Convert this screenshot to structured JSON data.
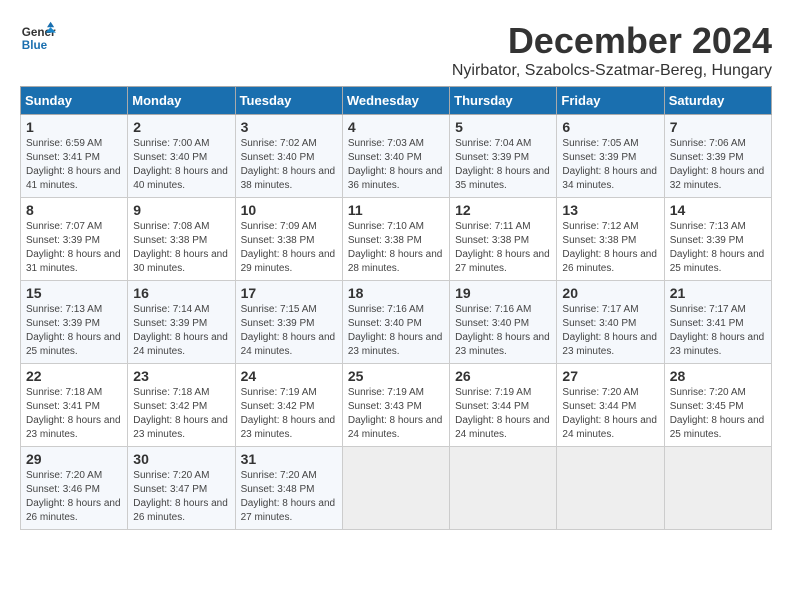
{
  "logo": {
    "line1": "General",
    "line2": "Blue"
  },
  "title": "December 2024",
  "subtitle": "Nyirbator, Szabolcs-Szatmar-Bereg, Hungary",
  "weekdays": [
    "Sunday",
    "Monday",
    "Tuesday",
    "Wednesday",
    "Thursday",
    "Friday",
    "Saturday"
  ],
  "weeks": [
    [
      {
        "day": "1",
        "sunrise": "Sunrise: 6:59 AM",
        "sunset": "Sunset: 3:41 PM",
        "daylight": "Daylight: 8 hours and 41 minutes."
      },
      {
        "day": "2",
        "sunrise": "Sunrise: 7:00 AM",
        "sunset": "Sunset: 3:40 PM",
        "daylight": "Daylight: 8 hours and 40 minutes."
      },
      {
        "day": "3",
        "sunrise": "Sunrise: 7:02 AM",
        "sunset": "Sunset: 3:40 PM",
        "daylight": "Daylight: 8 hours and 38 minutes."
      },
      {
        "day": "4",
        "sunrise": "Sunrise: 7:03 AM",
        "sunset": "Sunset: 3:40 PM",
        "daylight": "Daylight: 8 hours and 36 minutes."
      },
      {
        "day": "5",
        "sunrise": "Sunrise: 7:04 AM",
        "sunset": "Sunset: 3:39 PM",
        "daylight": "Daylight: 8 hours and 35 minutes."
      },
      {
        "day": "6",
        "sunrise": "Sunrise: 7:05 AM",
        "sunset": "Sunset: 3:39 PM",
        "daylight": "Daylight: 8 hours and 34 minutes."
      },
      {
        "day": "7",
        "sunrise": "Sunrise: 7:06 AM",
        "sunset": "Sunset: 3:39 PM",
        "daylight": "Daylight: 8 hours and 32 minutes."
      }
    ],
    [
      {
        "day": "8",
        "sunrise": "Sunrise: 7:07 AM",
        "sunset": "Sunset: 3:39 PM",
        "daylight": "Daylight: 8 hours and 31 minutes."
      },
      {
        "day": "9",
        "sunrise": "Sunrise: 7:08 AM",
        "sunset": "Sunset: 3:38 PM",
        "daylight": "Daylight: 8 hours and 30 minutes."
      },
      {
        "day": "10",
        "sunrise": "Sunrise: 7:09 AM",
        "sunset": "Sunset: 3:38 PM",
        "daylight": "Daylight: 8 hours and 29 minutes."
      },
      {
        "day": "11",
        "sunrise": "Sunrise: 7:10 AM",
        "sunset": "Sunset: 3:38 PM",
        "daylight": "Daylight: 8 hours and 28 minutes."
      },
      {
        "day": "12",
        "sunrise": "Sunrise: 7:11 AM",
        "sunset": "Sunset: 3:38 PM",
        "daylight": "Daylight: 8 hours and 27 minutes."
      },
      {
        "day": "13",
        "sunrise": "Sunrise: 7:12 AM",
        "sunset": "Sunset: 3:38 PM",
        "daylight": "Daylight: 8 hours and 26 minutes."
      },
      {
        "day": "14",
        "sunrise": "Sunrise: 7:13 AM",
        "sunset": "Sunset: 3:39 PM",
        "daylight": "Daylight: 8 hours and 25 minutes."
      }
    ],
    [
      {
        "day": "15",
        "sunrise": "Sunrise: 7:13 AM",
        "sunset": "Sunset: 3:39 PM",
        "daylight": "Daylight: 8 hours and 25 minutes."
      },
      {
        "day": "16",
        "sunrise": "Sunrise: 7:14 AM",
        "sunset": "Sunset: 3:39 PM",
        "daylight": "Daylight: 8 hours and 24 minutes."
      },
      {
        "day": "17",
        "sunrise": "Sunrise: 7:15 AM",
        "sunset": "Sunset: 3:39 PM",
        "daylight": "Daylight: 8 hours and 24 minutes."
      },
      {
        "day": "18",
        "sunrise": "Sunrise: 7:16 AM",
        "sunset": "Sunset: 3:40 PM",
        "daylight": "Daylight: 8 hours and 23 minutes."
      },
      {
        "day": "19",
        "sunrise": "Sunrise: 7:16 AM",
        "sunset": "Sunset: 3:40 PM",
        "daylight": "Daylight: 8 hours and 23 minutes."
      },
      {
        "day": "20",
        "sunrise": "Sunrise: 7:17 AM",
        "sunset": "Sunset: 3:40 PM",
        "daylight": "Daylight: 8 hours and 23 minutes."
      },
      {
        "day": "21",
        "sunrise": "Sunrise: 7:17 AM",
        "sunset": "Sunset: 3:41 PM",
        "daylight": "Daylight: 8 hours and 23 minutes."
      }
    ],
    [
      {
        "day": "22",
        "sunrise": "Sunrise: 7:18 AM",
        "sunset": "Sunset: 3:41 PM",
        "daylight": "Daylight: 8 hours and 23 minutes."
      },
      {
        "day": "23",
        "sunrise": "Sunrise: 7:18 AM",
        "sunset": "Sunset: 3:42 PM",
        "daylight": "Daylight: 8 hours and 23 minutes."
      },
      {
        "day": "24",
        "sunrise": "Sunrise: 7:19 AM",
        "sunset": "Sunset: 3:42 PM",
        "daylight": "Daylight: 8 hours and 23 minutes."
      },
      {
        "day": "25",
        "sunrise": "Sunrise: 7:19 AM",
        "sunset": "Sunset: 3:43 PM",
        "daylight": "Daylight: 8 hours and 24 minutes."
      },
      {
        "day": "26",
        "sunrise": "Sunrise: 7:19 AM",
        "sunset": "Sunset: 3:44 PM",
        "daylight": "Daylight: 8 hours and 24 minutes."
      },
      {
        "day": "27",
        "sunrise": "Sunrise: 7:20 AM",
        "sunset": "Sunset: 3:44 PM",
        "daylight": "Daylight: 8 hours and 24 minutes."
      },
      {
        "day": "28",
        "sunrise": "Sunrise: 7:20 AM",
        "sunset": "Sunset: 3:45 PM",
        "daylight": "Daylight: 8 hours and 25 minutes."
      }
    ],
    [
      {
        "day": "29",
        "sunrise": "Sunrise: 7:20 AM",
        "sunset": "Sunset: 3:46 PM",
        "daylight": "Daylight: 8 hours and 26 minutes."
      },
      {
        "day": "30",
        "sunrise": "Sunrise: 7:20 AM",
        "sunset": "Sunset: 3:47 PM",
        "daylight": "Daylight: 8 hours and 26 minutes."
      },
      {
        "day": "31",
        "sunrise": "Sunrise: 7:20 AM",
        "sunset": "Sunset: 3:48 PM",
        "daylight": "Daylight: 8 hours and 27 minutes."
      },
      null,
      null,
      null,
      null
    ]
  ]
}
